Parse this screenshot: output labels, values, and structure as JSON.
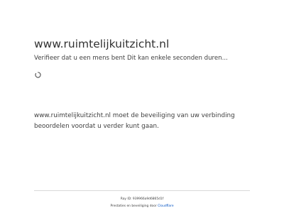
{
  "header": {
    "site_title": "www.ruimtelijkuitzicht.nl",
    "verify_message": "Verifieer dat u een mens bent Dit kan enkele seconden duren..."
  },
  "spinner": {
    "icon": "loading-spinner-icon"
  },
  "security": {
    "message": "www.ruimtelijkuitzicht.nl moet de beveiliging van uw verbinding beoordelen voordat u verder kunt gaan."
  },
  "footer": {
    "ray_id": "Ray ID: 939966a9d6865d1f",
    "provided_by": "Prestaties en beveiliging door",
    "provider_link": "Cloudflare"
  },
  "colors": {
    "text": "#313131",
    "link": "#0051c3",
    "divider": "#d9d9d9"
  }
}
